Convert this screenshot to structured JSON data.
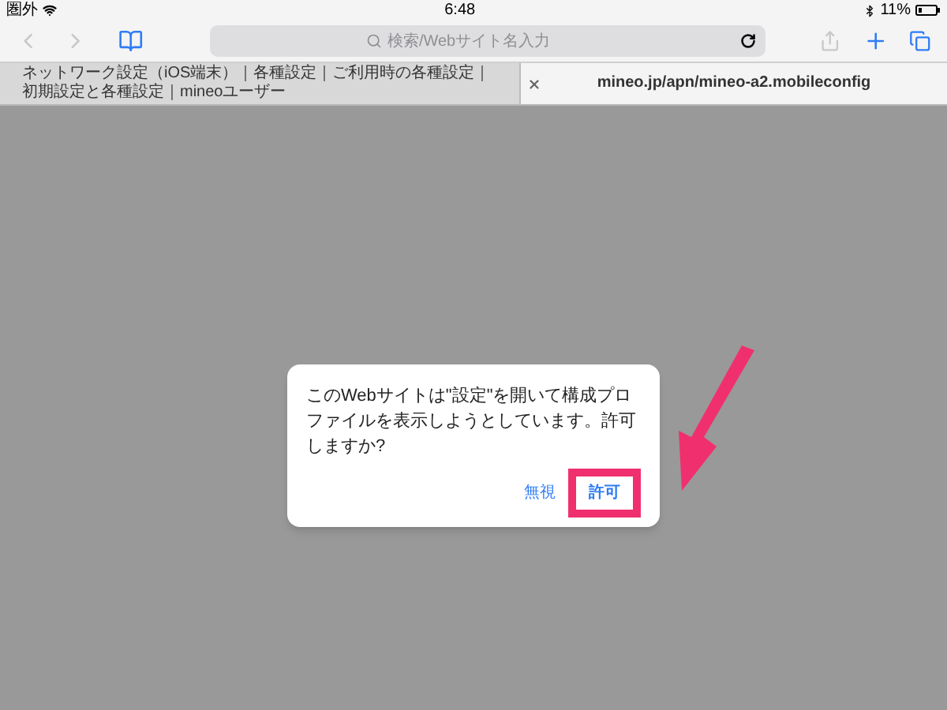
{
  "status_bar": {
    "carrier": "圏外",
    "time": "6:48",
    "battery": "11%"
  },
  "toolbar": {
    "back_disabled": true,
    "forward_disabled": true,
    "address": {
      "placeholder": "検索/Webサイト名入力"
    },
    "share_disabled": true
  },
  "tabs": [
    {
      "label": "ネットワーク設定（iOS端末）｜各種設定｜ご利用時の各種設定｜初期設定と各種設定｜mineoユーザー",
      "selected": false
    },
    {
      "label": "mineo.jp/apn/mineo-a2.mobileconfig",
      "selected": true
    }
  ],
  "dialog": {
    "message": "このWebサイトは\"設定\"を開いて構成プロファイルを表示しようとしています。許可しますか?",
    "buttons": [
      {
        "label": "無視",
        "primary": false,
        "highlighted": false
      },
      {
        "label": "許可",
        "primary": true,
        "highlighted": true
      }
    ]
  }
}
